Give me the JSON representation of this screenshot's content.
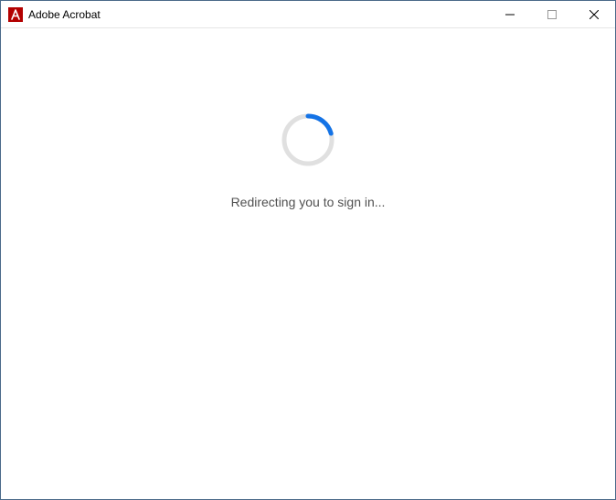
{
  "window": {
    "title": "Adobe Acrobat",
    "app_icon": "acrobat-icon"
  },
  "content": {
    "status_text": "Redirecting you to sign in...",
    "spinner_track_color": "#e0e0e0",
    "spinner_arc_color": "#1473e6"
  }
}
